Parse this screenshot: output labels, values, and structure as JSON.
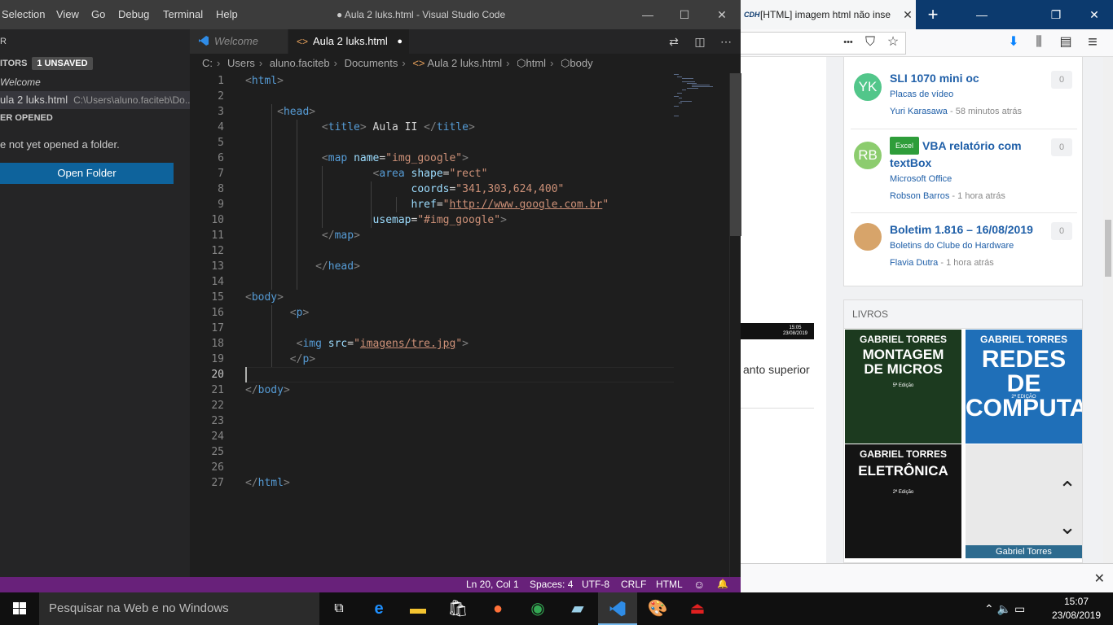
{
  "browser": {
    "tab_favicon": "CDH",
    "tab_title": "[HTML] imagem html não inse",
    "tab_close": "✕",
    "new_tab": "+",
    "controls": {
      "minimize": "—",
      "restore": "❐",
      "close": "✕"
    },
    "toolbar": {
      "more": "•••",
      "pocket": "⛉",
      "star": "☆",
      "download": "⬇",
      "library": "⫼",
      "reader": "▤",
      "menu": "≡"
    },
    "snippet_text": "anto superior",
    "mini_time": "15:05",
    "mini_date": "23/08/2019",
    "topics": [
      {
        "initials": "YK",
        "avatar_color": "#52c68a",
        "title": "SLI 1070 mini oc",
        "badge": "",
        "category": "Placas de vídeo",
        "author": "Yuri Karasawa",
        "time": " - 58 minutos atrás",
        "count": "0"
      },
      {
        "initials": "RB",
        "avatar_color": "#8ccc6e",
        "title": "VBA relatório com textBox",
        "badge": "Excel",
        "category": "Microsoft Office",
        "author": "Robson Barros",
        "time": " - 1 hora atrás",
        "count": "0"
      },
      {
        "initials": "",
        "avatar_color": "#d7a46a",
        "title": "Boletim 1.816 – 16/08/2019",
        "badge": "",
        "category": "Boletins do Clube do Hardware",
        "author": "Flavia Dutra",
        "time": " - 1 hora atrás",
        "count": "0"
      }
    ],
    "livros_heading": "LIVROS",
    "books": [
      {
        "author": "GABRIEL TORRES",
        "title": "MONTAGEM DE MICROS",
        "edition": "5ª Edição",
        "color": "#1c3a1f"
      },
      {
        "author": "GABRIEL TORRES",
        "title": "REDES DE COMPUTADORES",
        "edition": "2ª EDIÇÃO",
        "color": "#1f6fb8"
      },
      {
        "author": "GABRIEL TORRES",
        "title": "ELETRÔNICA",
        "edition": "2ª Edição",
        "color": "#141414"
      },
      {
        "author": "Gabriel Torres",
        "title": "",
        "edition": "",
        "color": "#e9e9e9"
      }
    ],
    "scroll_up": "⌃",
    "scroll_down": "⌄",
    "find_close": "✕"
  },
  "vscode": {
    "menu": [
      "Selection",
      "View",
      "Go",
      "Debug",
      "Terminal",
      "Help"
    ],
    "window_title": "● Aula 2 luks.html - Visual Studio Code",
    "controls": {
      "minimize": "—",
      "maximize": "☐",
      "close": "✕"
    },
    "sidebar": {
      "explorer_label": "R",
      "open_editors_label": "ITORS",
      "unsaved_badge": "1 UNSAVED",
      "editors": [
        {
          "name": "Welcome",
          "path": ""
        },
        {
          "name": "ula 2 luks.html",
          "path": "C:\\Users\\aluno.faciteb\\Do..."
        }
      ],
      "folder_section": "ER OPENED",
      "no_folder_text": "e not yet opened a folder.",
      "open_folder_button": "Open Folder"
    },
    "tabs": [
      {
        "label": "Welcome",
        "icon": "vscode-icon",
        "active": false
      },
      {
        "label": "Aula 2 luks.html",
        "icon": "html-icon",
        "active": true,
        "dirty": "●"
      }
    ],
    "breadcrumb": [
      "C:",
      "Users",
      "aluno.faciteb",
      "Documents",
      "Aula 2 luks.html",
      "html",
      "body"
    ],
    "line_numbers": [
      "1",
      "2",
      "3",
      "4",
      "5",
      "6",
      "7",
      "8",
      "9",
      "10",
      "11",
      "12",
      "13",
      "14",
      "15",
      "16",
      "17",
      "18",
      "19",
      "20",
      "21",
      "22",
      "23",
      "24",
      "25",
      "26",
      "27"
    ],
    "current_line": 20,
    "status": {
      "position": "Ln 20, Col 1",
      "spaces": "Spaces: 4",
      "encoding": "UTF-8",
      "eol": "CRLF",
      "language": "HTML",
      "feedback": "☺",
      "bell": "🔔"
    }
  },
  "taskbar": {
    "search_placeholder": "Pesquisar na Web e no Windows",
    "tray": "⌃  🔈  ▭",
    "time": "15:07",
    "date": "23/08/2019"
  }
}
